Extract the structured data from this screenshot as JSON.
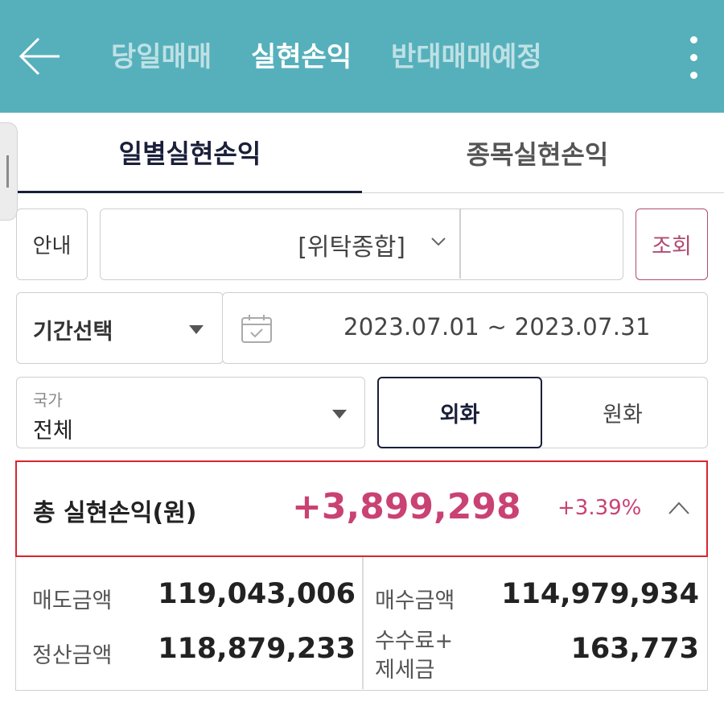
{
  "header": {
    "tabs": [
      {
        "label": "당일매매",
        "active": false
      },
      {
        "label": "실현손익",
        "active": true
      },
      {
        "label": "반대매매예정",
        "active": false
      }
    ],
    "back_icon": "arrow-left-icon",
    "menu_icon": "kebab-menu-icon",
    "bg_color": "#56b0bb"
  },
  "subtabs": [
    {
      "label": "일별실현손익",
      "active": true
    },
    {
      "label": "종목실현손익",
      "active": false
    }
  ],
  "filters": {
    "guide_label": "안내",
    "account_label": "[위탁종합]",
    "search_label": "조회",
    "period_label": "기간선택",
    "date_range": "2023.07.01 ~ 2023.07.31",
    "country_caption": "국가",
    "country_value": "전체",
    "currency_options": [
      {
        "label": "외화",
        "selected": true
      },
      {
        "label": "원화",
        "selected": false
      }
    ]
  },
  "summary": {
    "total_label": "총 실현손익(원)",
    "total_amount": "+3,899,298",
    "total_pct": "+3.39%",
    "accent_color": "#c94273",
    "highlight_border": "#d9252f"
  },
  "details": {
    "sell_label": "매도금액",
    "sell_value": "119,043,006",
    "buy_label": "매수금액",
    "buy_value": "114,979,934",
    "settle_label": "정산금액",
    "settle_value": "118,879,233",
    "fee_label_line1": "수수료+",
    "fee_label_line2": "제세금",
    "fee_value": "163,773"
  }
}
